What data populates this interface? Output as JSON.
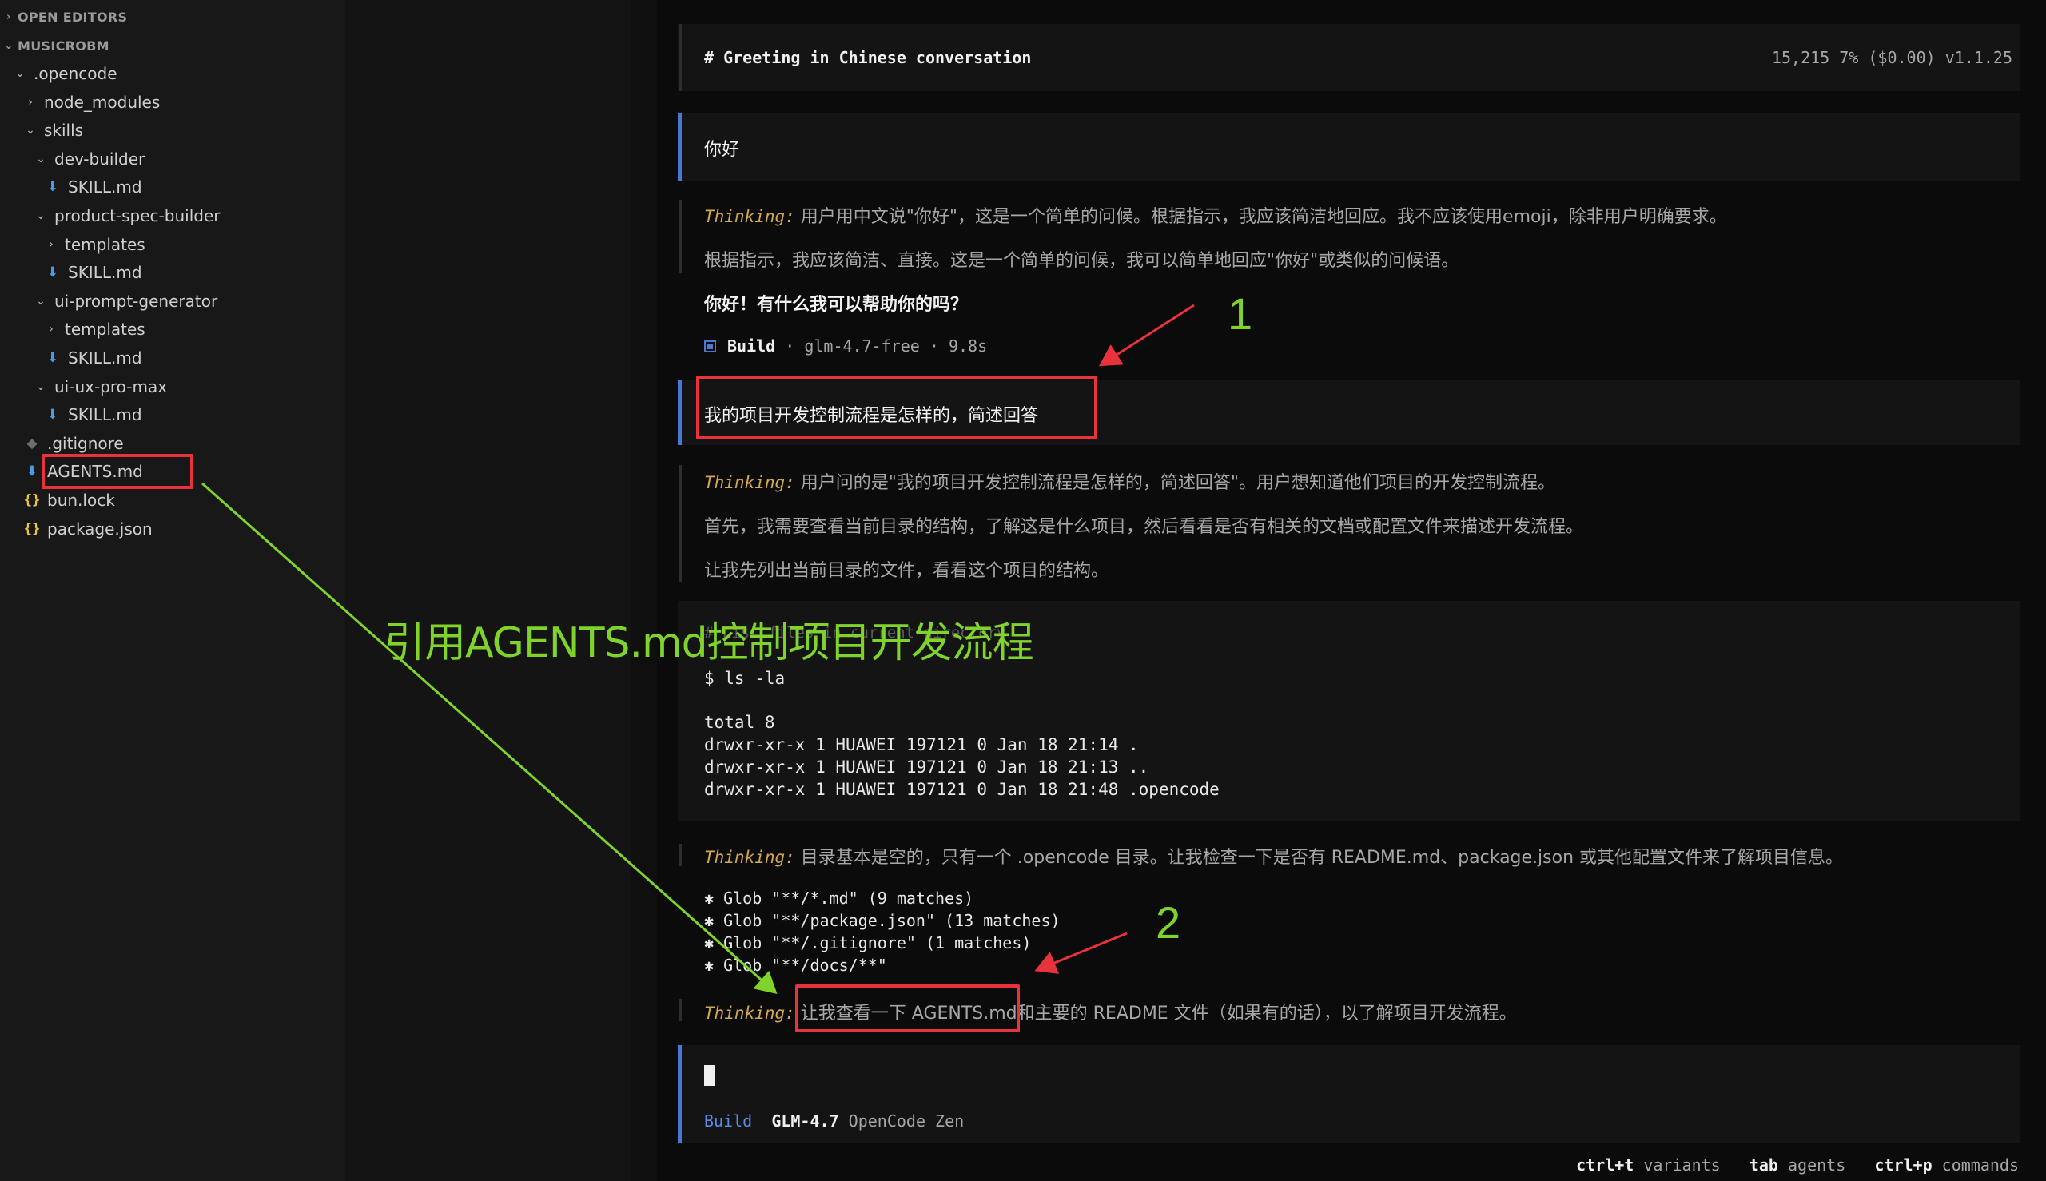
{
  "explorer": {
    "sections": [
      {
        "label": "OPEN EDITORS"
      },
      {
        "label": "MUSICROBM"
      }
    ],
    "tree": [
      {
        "label": ".opencode",
        "kind": "folder-open",
        "depth": 0
      },
      {
        "label": "node_modules",
        "kind": "folder-closed",
        "depth": 1
      },
      {
        "label": "skills",
        "kind": "folder-open",
        "depth": 1
      },
      {
        "label": "dev-builder",
        "kind": "folder-open",
        "depth": 2
      },
      {
        "label": "SKILL.md",
        "kind": "md",
        "depth": 3
      },
      {
        "label": "product-spec-builder",
        "kind": "folder-open",
        "depth": 2
      },
      {
        "label": "templates",
        "kind": "folder-closed",
        "depth": 3
      },
      {
        "label": "SKILL.md",
        "kind": "md",
        "depth": 3
      },
      {
        "label": "ui-prompt-generator",
        "kind": "folder-open",
        "depth": 2
      },
      {
        "label": "templates",
        "kind": "folder-closed",
        "depth": 3
      },
      {
        "label": "SKILL.md",
        "kind": "md",
        "depth": 3
      },
      {
        "label": "ui-ux-pro-max",
        "kind": "folder-open",
        "depth": 2
      },
      {
        "label": "SKILL.md",
        "kind": "md",
        "depth": 3
      },
      {
        "label": ".gitignore",
        "kind": "git",
        "depth": 1
      },
      {
        "label": "AGENTS.md",
        "kind": "md",
        "depth": 1
      },
      {
        "label": "bun.lock",
        "kind": "json",
        "depth": 1
      },
      {
        "label": "package.json",
        "kind": "json",
        "depth": 1
      }
    ]
  },
  "header": {
    "title": "# Greeting in Chinese conversation",
    "stats": "15,215  7% ($0.00) v1.1.25"
  },
  "conversation": {
    "user_msg_1": "你好",
    "thinking_label": "Thinking:",
    "thinking_1a": "用户用中文说\"你好\"，这是一个简单的问候。根据指示，我应该简洁地回应。我不应该使用emoji，除非用户明确要求。",
    "thinking_1b": "根据指示，我应该简洁、直接。这是一个简单的问候，我可以简单地回应\"你好\"或类似的问候语。",
    "reply_1": "你好！有什么我可以帮助你的吗？",
    "build_1": {
      "agent": "Build",
      "meta": "· glm-4.7-free · 9.8s"
    },
    "user_msg_2": "我的项目开发控制流程是怎样的，简述回答",
    "thinking_2a": "用户问的是\"我的项目开发控制流程是怎样的，简述回答\"。用户想知道他们项目的开发控制流程。",
    "thinking_2b": "首先，我需要查看当前目录的结构，了解这是什么项目，然后看看是否有相关的文档或配置文件来描述开发流程。",
    "thinking_2c": "让我先列出当前目录的文件，看看这个项目的结构。",
    "command": {
      "hidden_header": "# List files in current directory",
      "prompt": "$ ls -la",
      "output": [
        "total 8",
        "drwxr-xr-x 1 HUAWEI 197121 0 Jan 18 21:14 .",
        "drwxr-xr-x 1 HUAWEI 197121 0 Jan 18 21:13 ..",
        "drwxr-xr-x 1 HUAWEI 197121 0 Jan 18 21:48 .opencode"
      ]
    },
    "thinking_3": "目录基本是空的，只有一个 .opencode 目录。让我检查一下是否有 README.md、package.json 或其他配置文件来了解项目信息。",
    "globs": [
      "Glob \"**/*.md\" (9 matches)",
      "Glob \"**/package.json\" (13 matches)",
      "Glob \"**/.gitignore\" (1 matches)",
      "Glob \"**/docs/**\""
    ],
    "thinking_4_highlight": "让我查看一下 AGENTS.md",
    "thinking_4_rest": "和主要的 README 文件（如果有的话），以了解项目开发流程。"
  },
  "input": {
    "agent": "Build",
    "model": "GLM-4.7",
    "provider": "OpenCode Zen"
  },
  "footer": [
    {
      "key": "ctrl+t",
      "label": "variants"
    },
    {
      "key": "tab",
      "label": "agents"
    },
    {
      "key": "ctrl+p",
      "label": "commands"
    }
  ],
  "annotations": {
    "label_1": "1",
    "label_2": "2",
    "caption": "引用AGENTS.md控制项目开发流程"
  },
  "colors": {
    "accent_blue": "#4a78d6",
    "thinking_orange": "#d4a84e",
    "annotation_red": "#e8323c",
    "annotation_green": "#7fd32b",
    "md_icon": "#4c9be8",
    "json_icon": "#e8c63e"
  }
}
